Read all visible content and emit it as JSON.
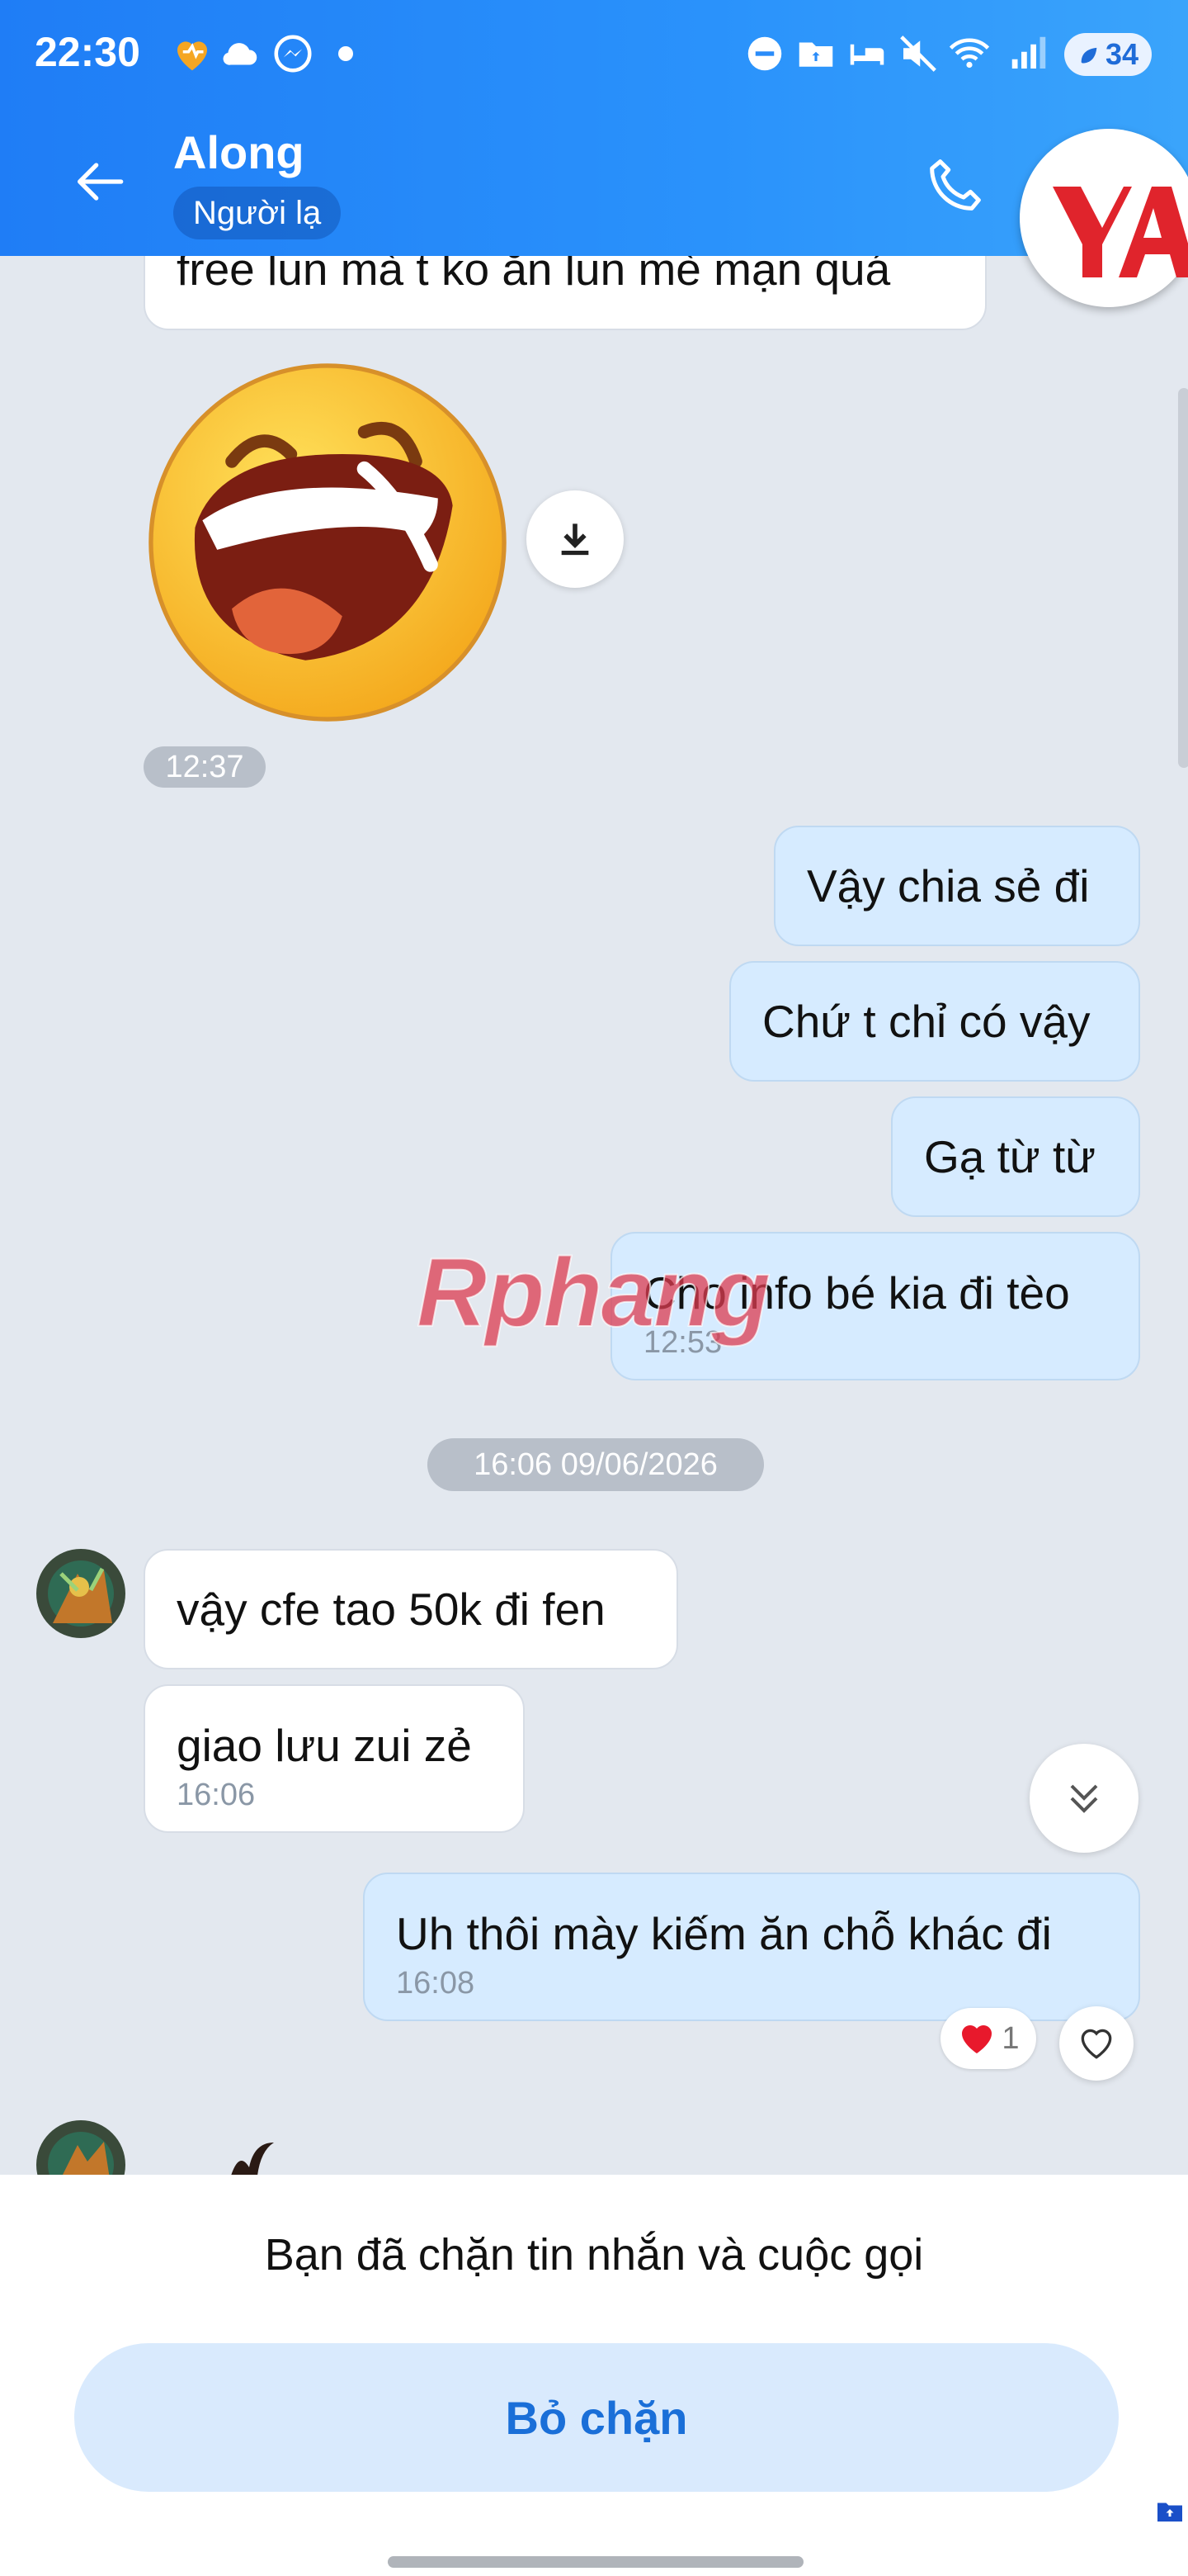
{
  "status_bar": {
    "time": "22:30",
    "battery": "34"
  },
  "header": {
    "name": "Along",
    "badge": "Người lạ"
  },
  "messages": {
    "m1": "free lun mà t ko ăn lun mè mạn quá",
    "sticker_time": "12:37",
    "m2": "Vậy chia sẻ đi",
    "m3": "Chứ t chỉ có vậy",
    "m4": "Gạ từ từ",
    "m5": "Cho info bé kia đi tèo",
    "m5_time": "12:53",
    "date_sep": "16:06 09/06/2026",
    "m6": "vậy cfe tao 50k đi fen",
    "m7": "giao lưu zui zẻ",
    "m7_time": "16:06",
    "m8": "Uh thôi mày kiếm ăn chỗ khác đi",
    "m8_time": "16:08",
    "reaction_count": "1"
  },
  "watermark": "Rphang",
  "footer": {
    "blocked_text": "Bạn đã chặn tin nhắn và cuộc gọi",
    "unblock_label": "Bỏ chặn"
  },
  "colors": {
    "header": "#2a8cf9",
    "accent": "#1a6fd8",
    "outgoing": "#d6ebff"
  }
}
